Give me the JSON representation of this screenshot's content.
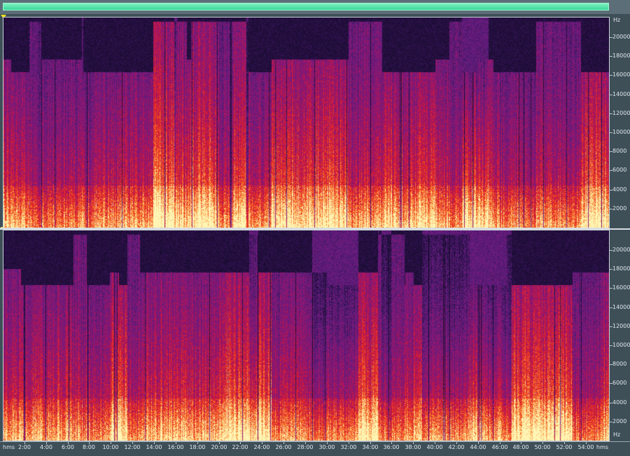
{
  "window": {
    "type": "spectral-view",
    "accent": "#3ad69a"
  },
  "overview": {
    "color": "#3ad69a"
  },
  "channels": [
    {
      "id": "left",
      "freq_unit": "Hz"
    },
    {
      "id": "right",
      "freq_unit": "Hz"
    }
  ],
  "freq_axis": {
    "unit": "Hz",
    "ticks": [
      "20000",
      "18000",
      "16000",
      "14000",
      "12000",
      "10000",
      "8000",
      "6000",
      "4000",
      "2000"
    ],
    "max_hz": 22050
  },
  "time_axis": {
    "unit_label": "hms",
    "unit_label_right": "hms",
    "ticks": [
      "2:00",
      "4:00",
      "6:00",
      "8:00",
      "10:00",
      "12:00",
      "14:00",
      "16:00",
      "18:00",
      "20:00",
      "22:00",
      "24:00",
      "26:00",
      "28:00",
      "30:00",
      "32:00",
      "34:00",
      "36:00",
      "38:00",
      "40:00",
      "42:00",
      "44:00",
      "46:00",
      "48:00",
      "50:00",
      "52:00",
      "54:00"
    ],
    "total_minutes": 56.2
  },
  "palette": {
    "low": "#1a0f2e",
    "mid": "#7a1a8a",
    "high": "#e0202a",
    "peak": "#fff0a0"
  }
}
